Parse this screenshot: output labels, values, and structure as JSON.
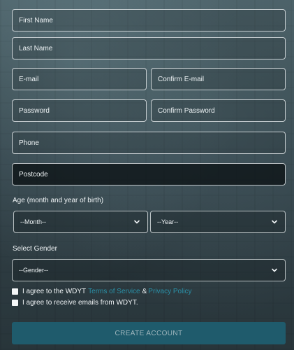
{
  "fields": {
    "first_name": "First Name",
    "last_name": "Last Name",
    "email": "E-mail",
    "confirm_email": "Confirm E-mail",
    "password": "Password",
    "confirm_password": "Confirm Password",
    "phone": "Phone",
    "postcode": "Postcode"
  },
  "age": {
    "label": "Age (month and year of birth)",
    "month_value": "--Month--",
    "year_value": "--Year--"
  },
  "gender": {
    "label": "Select Gender",
    "value": "--Gender--"
  },
  "agreements": {
    "terms_prefix": "I agree to the WDYT",
    "terms_link": "Terms of Service",
    "terms_amp": "&",
    "privacy_link": "Privacy Policy",
    "emails": "I agree to receive emails from WDYT."
  },
  "actions": {
    "create_account": "CREATE ACCOUNT"
  },
  "colors": {
    "accent": "#1f5b6c",
    "link": "#2a91a8"
  },
  "icons": {
    "dropdown": "chevron-down-icon",
    "checkbox": "checkbox-icon"
  }
}
